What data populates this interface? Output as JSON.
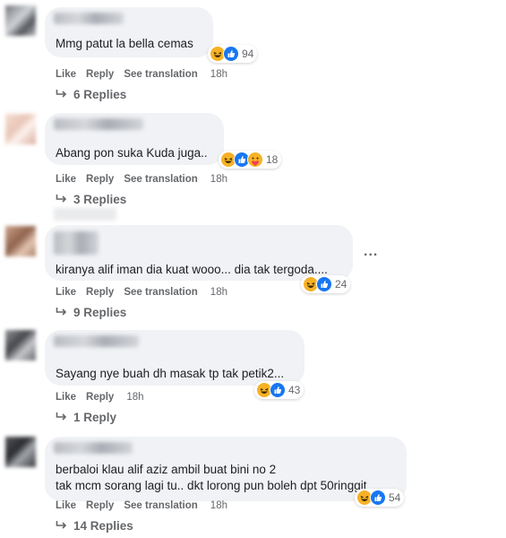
{
  "comments": [
    {
      "text_lines": [
        "Mmg patut la bella cemas"
      ],
      "reaction_count": "94",
      "reactions": [
        "haha",
        "like"
      ],
      "actions": [
        "Like",
        "Reply",
        "See translation"
      ],
      "time": "18h",
      "replies": "6 Replies"
    },
    {
      "text_lines": [
        "Abang pon suka Kuda juga.."
      ],
      "reaction_count": "18",
      "reactions": [
        "haha",
        "like",
        "care"
      ],
      "actions": [
        "Like",
        "Reply",
        "See translation"
      ],
      "time": "18h",
      "replies": "3 Replies"
    },
    {
      "text_lines": [
        "kiranya alif iman dia kuat wooo... dia tak tergoda...."
      ],
      "reaction_count": "24",
      "reactions": [
        "haha",
        "like"
      ],
      "actions": [
        "Like",
        "Reply",
        "See translation"
      ],
      "time": "18h",
      "replies": "9 Replies",
      "more_label": "..."
    },
    {
      "text_lines": [
        "Sayang nye buah dh masak tp tak petik2..."
      ],
      "reaction_count": "43",
      "reactions": [
        "haha",
        "like"
      ],
      "actions": [
        "Like",
        "Reply"
      ],
      "time": "18h",
      "replies": "1 Reply"
    },
    {
      "text_lines": [
        "berbaloi klau alif aziz ambil buat bini no 2",
        "tak mcm sorang lagi tu.. dkt lorong pun boleh dpt 50ringgit"
      ],
      "reaction_count": "54",
      "reactions": [
        "haha",
        "like"
      ],
      "actions": [
        "Like",
        "Reply",
        "See translation"
      ],
      "time": "18h",
      "replies": "14 Replies"
    }
  ],
  "colors": {
    "bubble": "#f0f2f5",
    "meta_text": "#65676b",
    "like_blue": "#1877f2",
    "haha_yellow": "#f7b125"
  }
}
